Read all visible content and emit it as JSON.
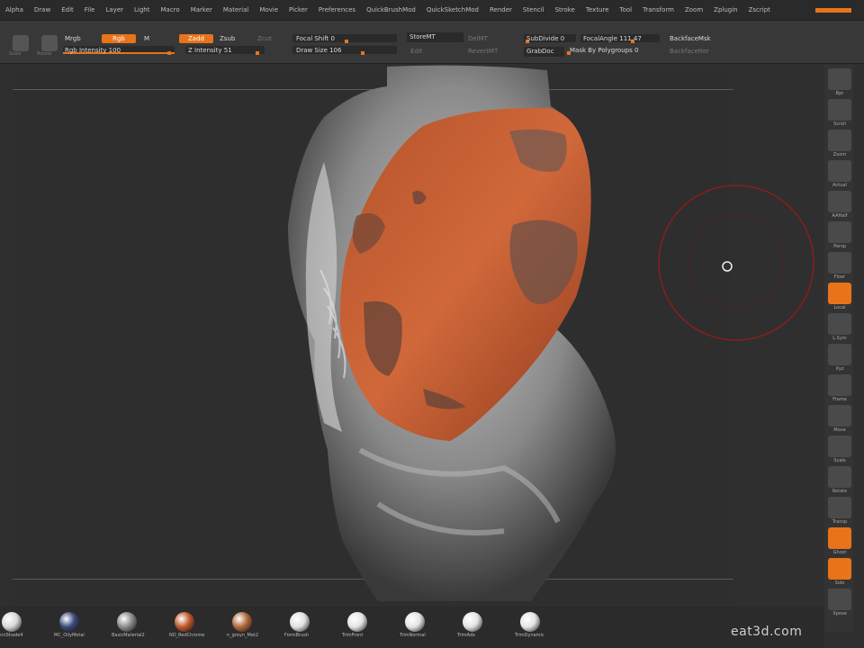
{
  "menu": [
    "Alpha",
    "Draw",
    "Edit",
    "File",
    "Layer",
    "Light",
    "Macro",
    "Marker",
    "Material",
    "Movie",
    "Picker",
    "Preferences",
    "QuickBrushMod",
    "QuickSketchMod",
    "Render",
    "Stencil",
    "Stroke",
    "Texture",
    "Tool",
    "Transform",
    "Zoom",
    "Zplugin",
    "Zscript"
  ],
  "toolbar": {
    "scale_label": "Scale",
    "rotate_label": "Rotate",
    "mrgb": "Mrgb",
    "rgb": "Rgb",
    "m": "M",
    "zadd": "Zadd",
    "zsub": "Zsub",
    "zcut": "Zcut",
    "rgb_intensity": "Rgb Intensity 100",
    "z_intensity": "Z Intensity 51",
    "focal_shift": "Focal Shift 0",
    "draw_size": "Draw Size 106",
    "stored": "StoreMT",
    "delmt": "DelMT",
    "edit": "Edit",
    "revertmt": "RevertMT",
    "subd": "SubDivide 0",
    "focal_angle": "FocalAngle 111.47",
    "backface": "BackfaceMsk",
    "grabdoc": "GrabDoc",
    "mask_by_poly": "Mask By Polygroups 0",
    "backtraceiter": "BackfaceIter"
  },
  "right_shelf": [
    "Bpr",
    "Scroll",
    "Zoom",
    "Actual",
    "AAHalf",
    "Persp",
    "Floor",
    "Local",
    "L.Sym",
    "Xyz",
    "Frame",
    "Move",
    "Scale",
    "Rotate",
    "Transp",
    "Ghost",
    "Solo",
    "Xpose"
  ],
  "materials": [
    "SkinShade4",
    "MC_OilyMetal",
    "BasicMaterial2",
    "NO_RedChrome",
    "n_greyn_Mat2",
    "FormBrush",
    "TrimFront",
    "TrimNormal",
    "TrimAdx",
    "TrimDynamic"
  ],
  "material_colors": [
    "#d8d8d8",
    "#3b4a7a",
    "#8a8a8a",
    "#c0582a",
    "#b06a3a",
    "#e0e0e0",
    "#e4e4e4",
    "#e4e4e4",
    "#e4e4e4",
    "#e4e4e4"
  ],
  "watermark": "eat3d.com",
  "colors": {
    "accent": "#e8731a",
    "mask": "#c0582a",
    "brush_ring": "#8a1d1d"
  }
}
